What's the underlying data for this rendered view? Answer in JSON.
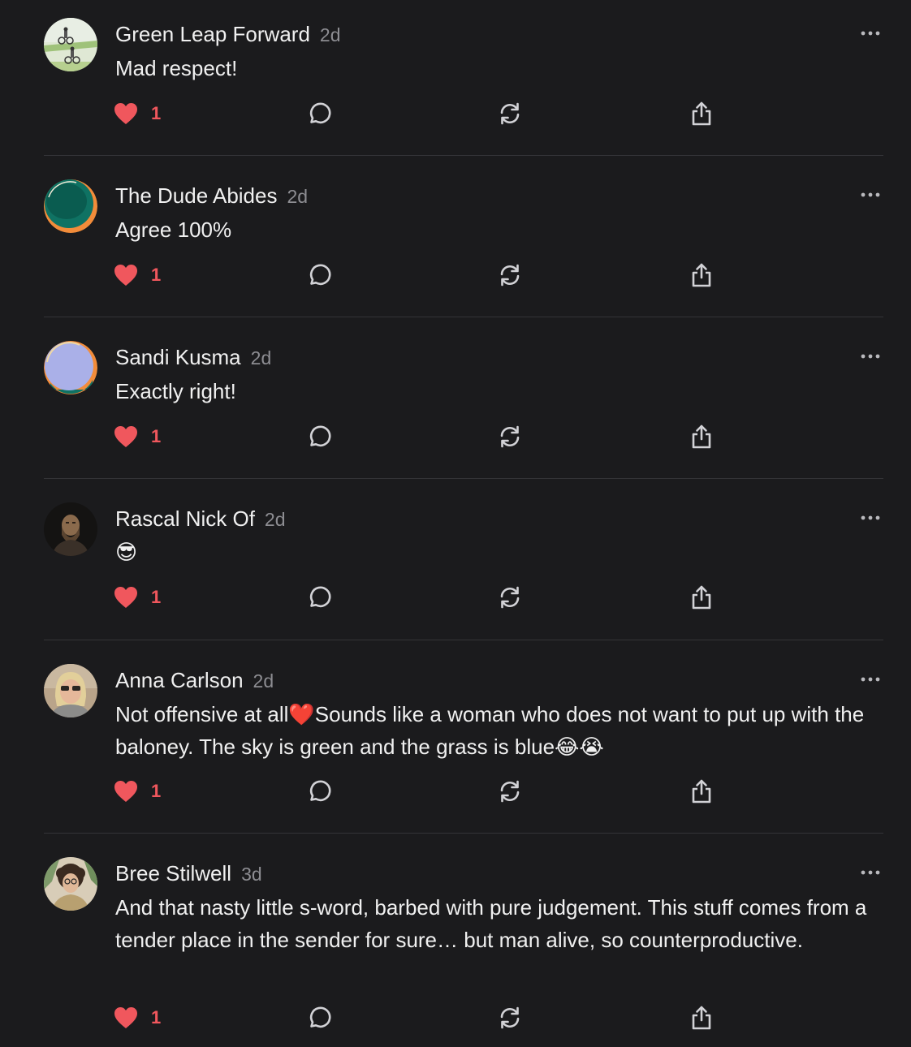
{
  "comments": [
    {
      "author": "Green Leap Forward",
      "age": "2d",
      "text": "Mad respect!",
      "likes": "1",
      "avatar_icon": "cyclists-photo"
    },
    {
      "author": "The Dude Abides",
      "age": "2d",
      "text": "Agree 100%",
      "likes": "1",
      "avatar_icon": "teal-orange-circle"
    },
    {
      "author": "Sandi Kusma",
      "age": "2d",
      "text": "Exactly right!",
      "likes": "1",
      "avatar_icon": "lavender-circle"
    },
    {
      "author": "Rascal Nick Of",
      "age": "2d",
      "text": "😎",
      "likes": "1",
      "avatar_icon": "bearded-man-portrait"
    },
    {
      "author": "Anna Carlson",
      "age": "2d",
      "text": "Not offensive at all❤️Sounds like a woman who does not want to put up with the baloney. The sky is green and the grass is blue😂😭",
      "likes": "1",
      "avatar_icon": "woman-sunglasses-photo"
    },
    {
      "author": "Bree Stilwell",
      "age": "3d",
      "text": "And that nasty little s-word, barbed with pure judgement. This stuff comes from a tender place in the sender for sure… but man alive, so counterproductive.",
      "likes": "1",
      "avatar_icon": "curly-hair-photo"
    }
  ],
  "icons": {
    "like": "heart-icon",
    "reply": "reply-bubble-icon",
    "restack": "restack-icon",
    "share": "share-icon",
    "more": "more-options-icon"
  },
  "colors": {
    "background": "#1b1b1d",
    "like_accent": "#f0575d",
    "muted": "#8d8d92",
    "icon": "#d2d2d6"
  }
}
